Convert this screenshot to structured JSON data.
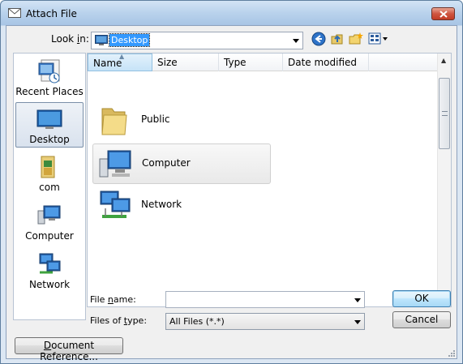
{
  "window": {
    "title": "Attach File"
  },
  "toolbar": {
    "look_in_label_prefix": "Look ",
    "look_in_label_accel": "i",
    "look_in_label_suffix": "n:",
    "look_in_value": "Desktop"
  },
  "places": [
    {
      "label": "Recent Places",
      "icon": "recent-places-icon"
    },
    {
      "label": "Desktop",
      "icon": "desktop-icon",
      "selected": true
    },
    {
      "label": "com",
      "icon": "user-folder-icon"
    },
    {
      "label": "Computer",
      "icon": "computer-icon"
    },
    {
      "label": "Network",
      "icon": "network-icon"
    }
  ],
  "columns": [
    "Name",
    "Size",
    "Type",
    "Date modified"
  ],
  "items": [
    {
      "label": "Public",
      "icon": "folder-icon"
    },
    {
      "label": "Computer",
      "icon": "computer-icon"
    },
    {
      "label": "Network",
      "icon": "network-icon"
    }
  ],
  "file_name": {
    "label_prefix": "File ",
    "label_accel": "n",
    "label_suffix": "ame:",
    "value": ""
  },
  "file_type": {
    "label_prefix": "Files of ",
    "label_accel": "t",
    "label_suffix": "ype:",
    "value": "All Files (*.*)"
  },
  "buttons": {
    "ok": "OK",
    "cancel": "Cancel",
    "docref_accel": "D",
    "docref_rest": "ocument Reference..."
  },
  "colors": {
    "selection": "#3399ff",
    "titlebar": "#b9d2ec",
    "close": "#cf5540"
  }
}
